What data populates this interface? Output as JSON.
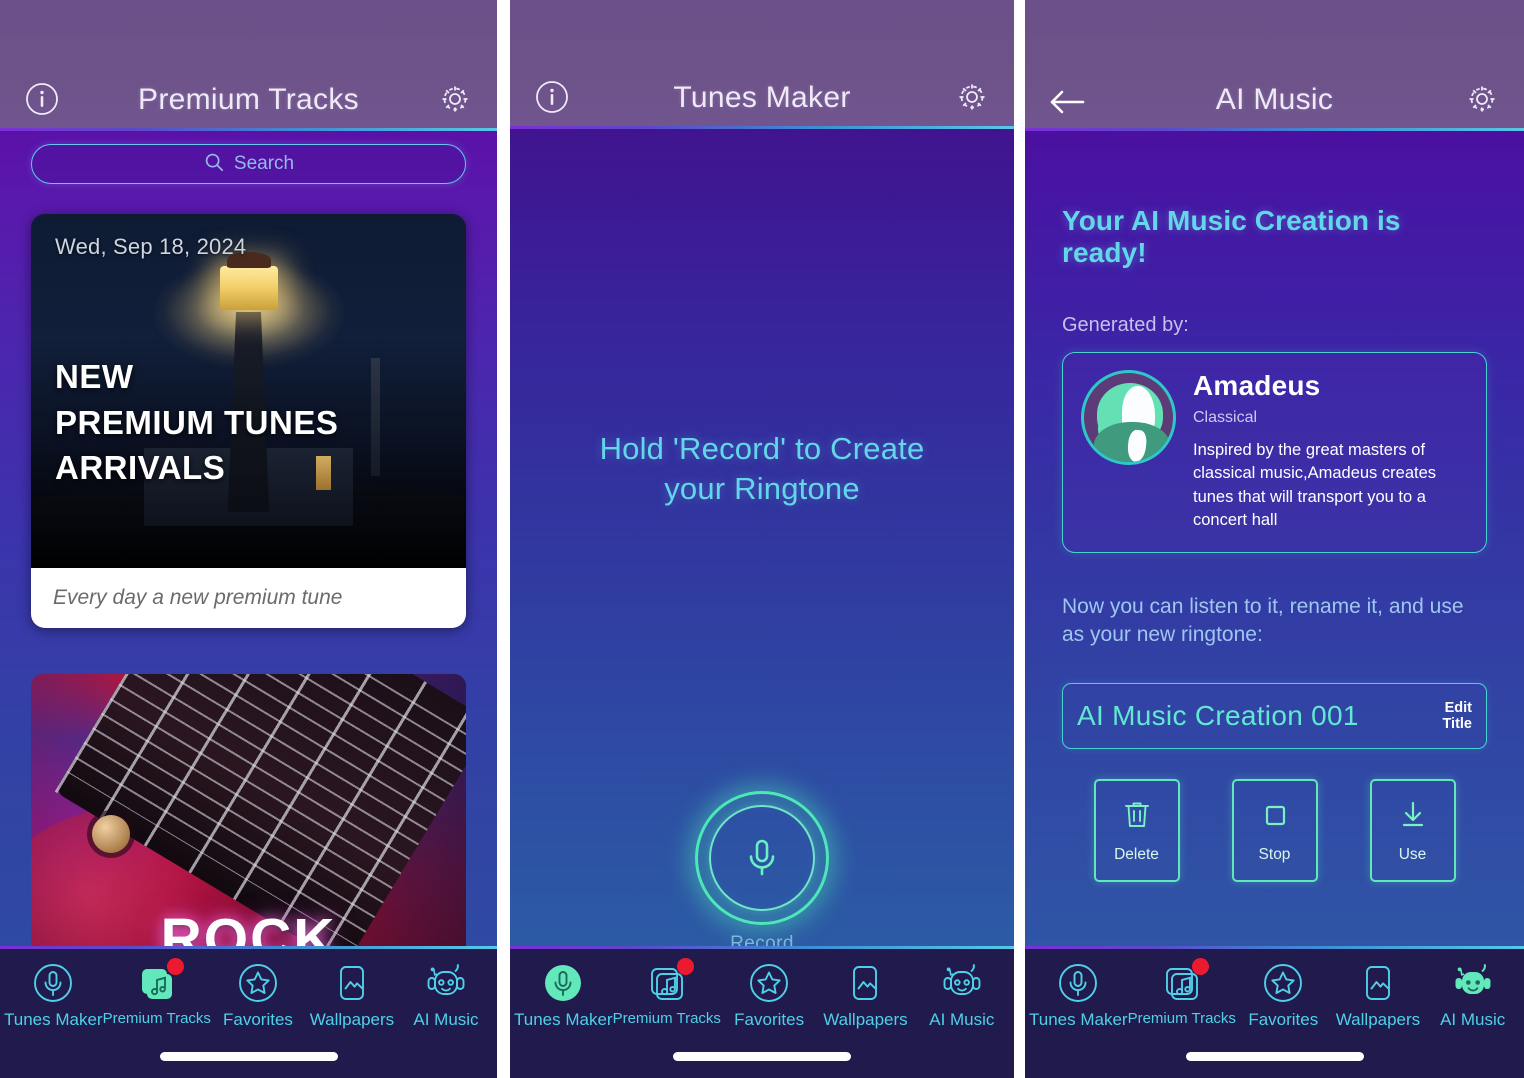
{
  "app": {
    "accent_teal": "#4fd0e8",
    "accent_green": "#5fe8bb",
    "header_purple": "#6b5089",
    "nav_bg": "#201a4d",
    "badge_red": "#ec1a2e"
  },
  "panel1": {
    "header": {
      "info_icon": "info-circle-icon",
      "title": "Premium Tracks",
      "settings_icon": "gear-icon"
    },
    "search": {
      "placeholder": "Search",
      "icon": "search-icon"
    },
    "promo_card": {
      "date": "Wed, Sep 18, 2024",
      "headline_line1": "NEW",
      "headline_line2": "PREMIUM TUNES",
      "headline_line3": "ARRIVALS",
      "caption": "Every day a new premium tune",
      "image_alt": "lighthouse-at-night"
    },
    "genre_card": {
      "title": "ROCK",
      "image_alt": "colorful-electric-guitar-art"
    }
  },
  "panel2": {
    "header": {
      "info_icon": "info-circle-icon",
      "title": "Tunes Maker",
      "settings_icon": "gear-icon"
    },
    "prompt_line1": "Hold 'Record' to Create",
    "prompt_line2": "your Ringtone",
    "record": {
      "label": "Record",
      "icon": "microphone-icon"
    }
  },
  "panel3": {
    "header": {
      "back_icon": "arrow-left-icon",
      "title": "AI Music",
      "settings_icon": "gear-icon"
    },
    "ready_title": "Your AI Music Creation is ready!",
    "generated_by_label": "Generated by:",
    "generator": {
      "name": "Amadeus",
      "genre": "Classical",
      "description": "Inspired by the great masters of classical music,Amadeus creates tunes that will transport you to a concert hall",
      "avatar_alt": "classical-composer-avatar"
    },
    "note": "Now you can listen to it, rename it, and use as your new ringtone:",
    "track": {
      "title": "AI Music Creation 001",
      "edit_line1": "Edit",
      "edit_line2": "Title"
    },
    "actions": [
      {
        "label": "Delete",
        "icon": "trash-icon"
      },
      {
        "label": "Stop",
        "icon": "stop-square-icon"
      },
      {
        "label": "Use",
        "icon": "download-arrow-icon"
      }
    ]
  },
  "nav": {
    "items": [
      {
        "label": "Tunes Maker",
        "icon": "microphone-circle-icon"
      },
      {
        "label": "Premium Tracks",
        "icon": "music-cards-icon",
        "badge": true
      },
      {
        "label": "Favorites",
        "icon": "star-circle-icon"
      },
      {
        "label": "Wallpapers",
        "icon": "image-frame-icon"
      },
      {
        "label": "AI Music",
        "icon": "robot-headphones-icon"
      }
    ],
    "active": {
      "panel1": "Premium Tracks",
      "panel2": "Tunes Maker",
      "panel3": "AI Music"
    }
  }
}
